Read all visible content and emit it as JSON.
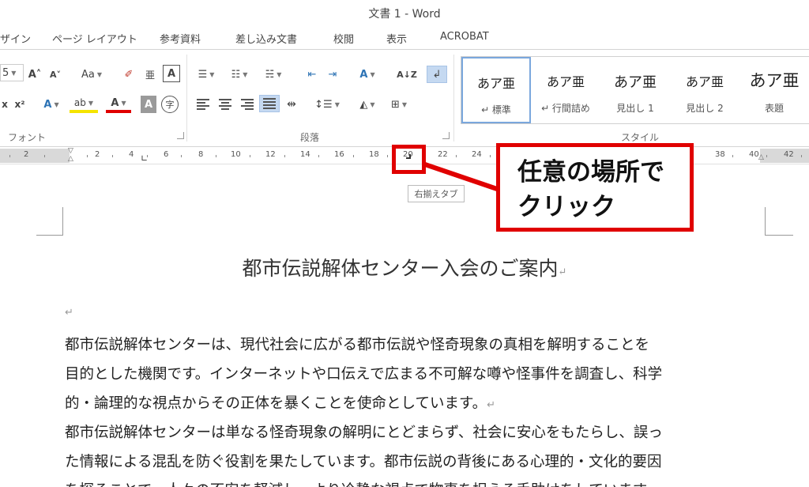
{
  "window": {
    "title": "文書 1 - Word"
  },
  "tabs": [
    "ザイン",
    "ページ レイアウト",
    "参考資料",
    "差し込み文書",
    "校閲",
    "表示",
    "ACROBAT"
  ],
  "ribbon": {
    "groups": {
      "font": "フォント",
      "paragraph": "段落",
      "styles": "スタイル"
    },
    "font_size_fragment": "5",
    "change_case": "Aa",
    "phonetic_guide": "亜",
    "superscript": "x²",
    "styles": [
      {
        "sample": "あア亜",
        "name": "↵ 標準"
      },
      {
        "sample": "あア亜",
        "name": "↵ 行間詰め"
      },
      {
        "sample": "あア亜",
        "name": "見出し 1"
      },
      {
        "sample": "あア亜",
        "name": "見出し 2"
      },
      {
        "sample": "あア亜",
        "name": "表題"
      }
    ]
  },
  "ruler": {
    "labels": [
      "2",
      "2",
      "4",
      "6",
      "8",
      "10",
      "12",
      "14",
      "16",
      "18",
      "20",
      "22",
      "24",
      "38",
      "40",
      "42"
    ]
  },
  "tooltip": "右揃えタブ",
  "callout": {
    "line1": "任意の場所で",
    "line2": "クリック"
  },
  "document": {
    "title": "都市伝説解体センター入会のご案内",
    "lines": [
      "都市伝説解体センターは、現代社会に広がる都市伝説や怪奇現象の真相を解明することを",
      "目的とした機関です。インターネットや口伝えで広まる不可解な噂や怪事件を調査し、科学",
      "的・論理的な視点からその正体を暴くことを使命としています。",
      "都市伝説解体センターは単なる怪奇現象の解明にとどまらず、社会に安心をもたらし、誤っ",
      "た情報による混乱を防ぐ役割を果たしています。都市伝説の背後にある心理的・文化的要因",
      "を探ることで、人々の不安を軽減し、より冷静な視点で物事を捉える手助けをしています。"
    ],
    "paragraph_mark": "↵"
  }
}
